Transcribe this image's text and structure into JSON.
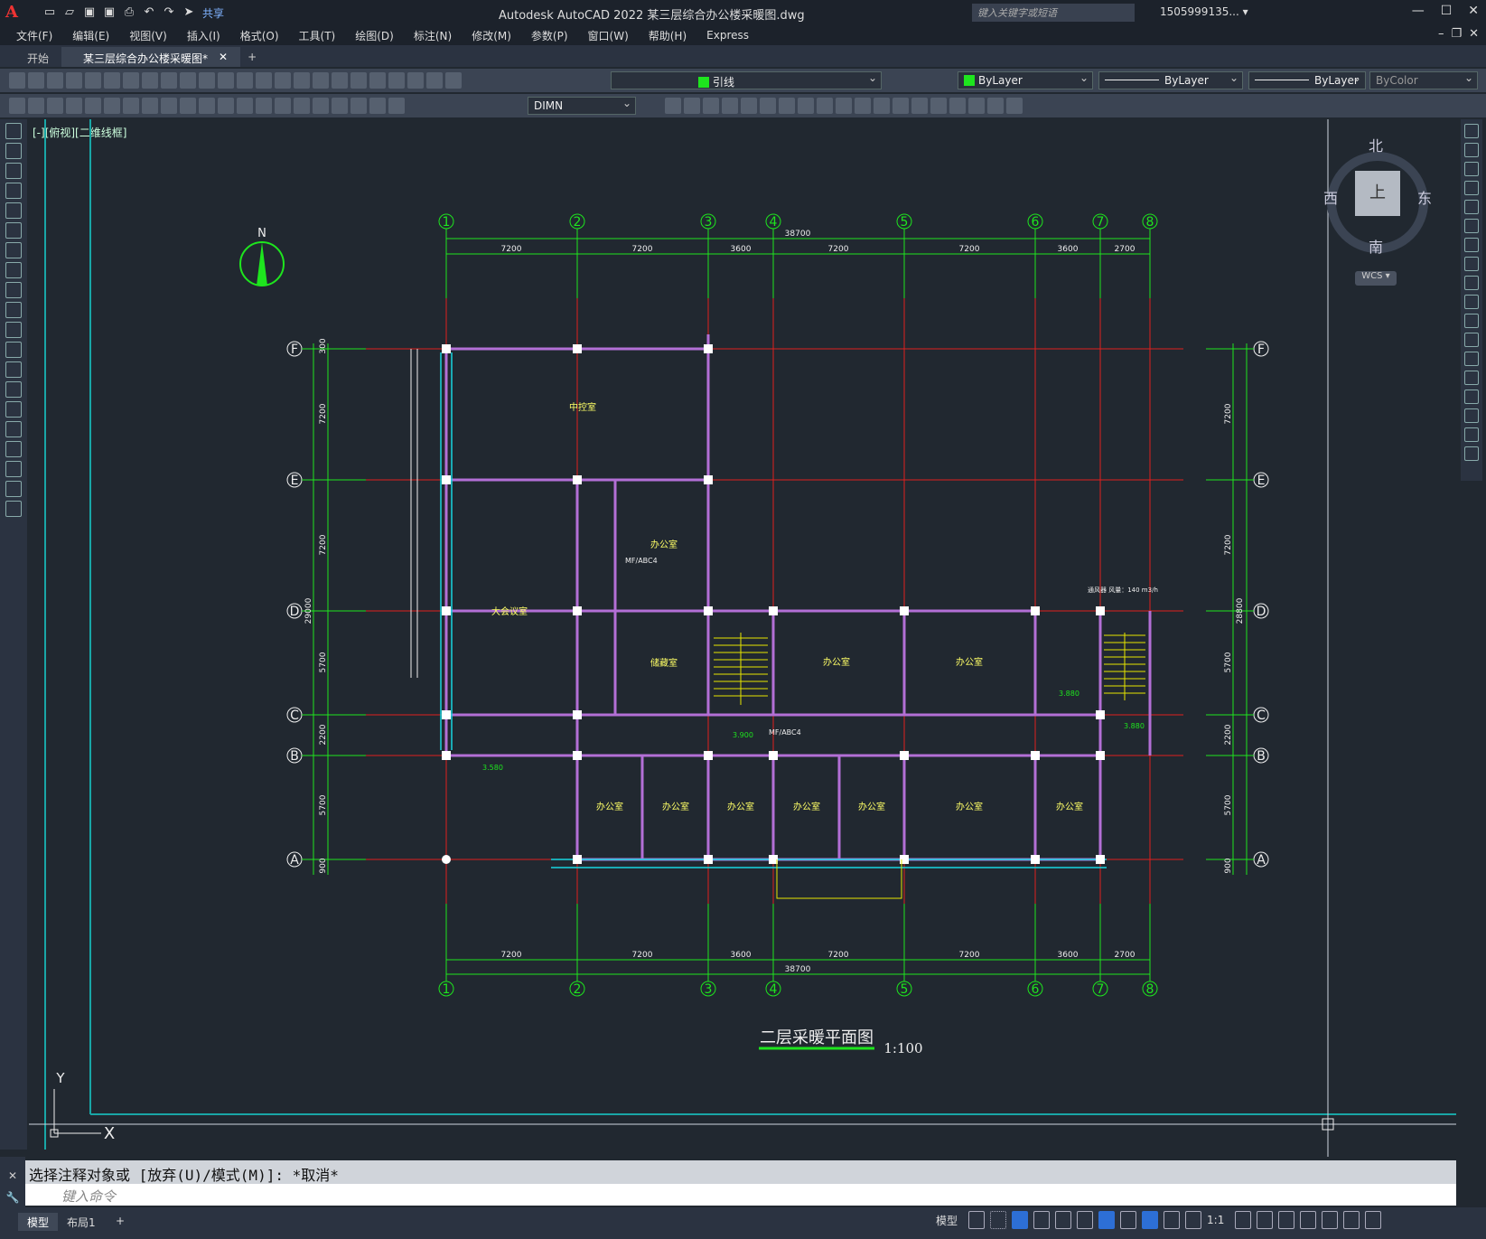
{
  "app": {
    "logo_letter": "A",
    "share_label": "共享",
    "title": "Autodesk AutoCAD 2022    某三层综合办公楼采暖图.dwg",
    "search_placeholder": "键入关键字或短语",
    "user": "1505999135... ▾"
  },
  "menu": [
    "文件(F)",
    "编辑(E)",
    "视图(V)",
    "插入(I)",
    "格式(O)",
    "工具(T)",
    "绘图(D)",
    "标注(N)",
    "修改(M)",
    "参数(P)",
    "窗口(W)",
    "帮助(H)",
    "Express"
  ],
  "tabs": {
    "start": "开始",
    "active": "某三层综合办公楼采暖图*"
  },
  "toolbar": {
    "layer": "引线",
    "color": "ByLayer",
    "linetype": "ByLayer",
    "lineweight": "ByLayer",
    "plotstyle": "ByColor",
    "dimstyle": "DIMN"
  },
  "view_label": "[-][俯视][二维线框]",
  "viewcube": {
    "north": "北",
    "south": "南",
    "east": "东",
    "west": "西",
    "face": "上",
    "wcs": "WCS ▾"
  },
  "drawing": {
    "north_label": "N",
    "axis_numbers": [
      "1",
      "2",
      "3",
      "4",
      "5",
      "6",
      "7",
      "8"
    ],
    "axis_letters": [
      "F",
      "E",
      "D",
      "C",
      "B",
      "A"
    ],
    "spans_top": [
      "7200",
      "7200",
      "3600",
      "7200",
      "7200",
      "3600",
      "2700"
    ],
    "total": "38700",
    "left_dims": [
      "300",
      "7200",
      "7200",
      "29000",
      "5700",
      "2200",
      "5700",
      "900"
    ],
    "right_dims": [
      "7200",
      "7200",
      "28800",
      "5700",
      "2200",
      "5700",
      "900"
    ],
    "rooms": {
      "control": "中控室",
      "office": "办公室",
      "conference": "大会议室",
      "storage": "储藏室"
    },
    "tags": [
      "MF/ABC4",
      "MF/ABC4",
      "3.900",
      "3.880",
      "3.880",
      "3.580",
      "通风器 风量：140 m3/h"
    ],
    "title": "二层采暖平面图",
    "scale": "1:100",
    "ucs_y": "Y",
    "ucs_x": "X"
  },
  "command": {
    "history": "选择注释对象或 [放弃(U)/模式(M)]: *取消*",
    "placeholder": "键入命令"
  },
  "status": {
    "tab_model": "模型",
    "tab_layout": "布局1",
    "model_btn": "模型",
    "scale": "1:1"
  }
}
